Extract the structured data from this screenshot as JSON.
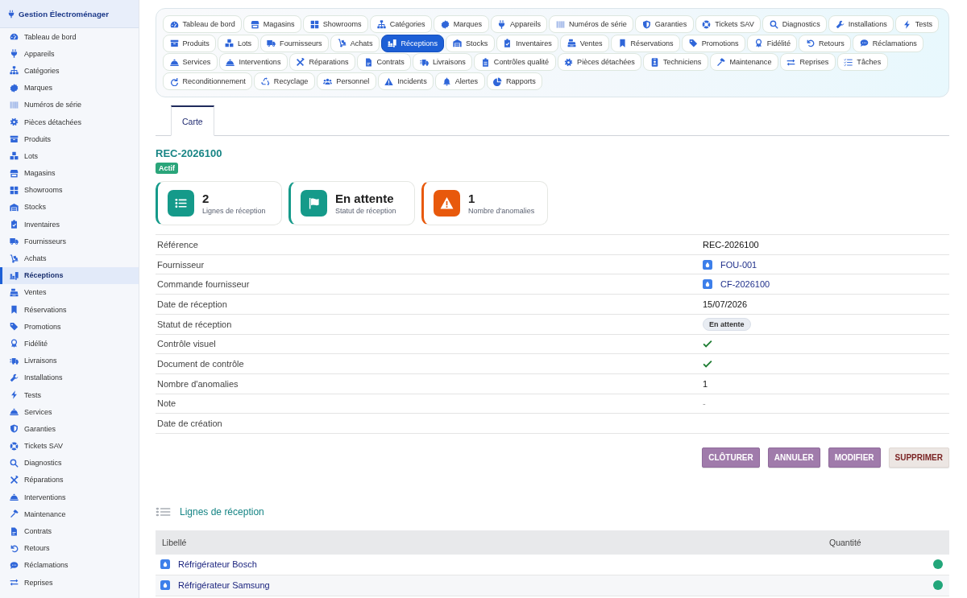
{
  "sidebar": {
    "title": "Gestion Électroménager",
    "items": [
      {
        "label": "Tableau de bord",
        "selected": false
      },
      {
        "label": "Appareils",
        "selected": false
      },
      {
        "label": "Catégories",
        "selected": false
      },
      {
        "label": "Marques",
        "selected": false
      },
      {
        "label": "Numéros de série",
        "selected": false
      },
      {
        "label": "Pièces détachées",
        "selected": false
      },
      {
        "label": "Produits",
        "selected": false
      },
      {
        "label": "Lots",
        "selected": false
      },
      {
        "label": "Magasins",
        "selected": false
      },
      {
        "label": "Showrooms",
        "selected": false
      },
      {
        "label": "Stocks",
        "selected": false
      },
      {
        "label": "Inventaires",
        "selected": false
      },
      {
        "label": "Fournisseurs",
        "selected": false
      },
      {
        "label": "Achats",
        "selected": false
      },
      {
        "label": "Réceptions",
        "selected": true
      },
      {
        "label": "Ventes",
        "selected": false
      },
      {
        "label": "Réservations",
        "selected": false
      },
      {
        "label": "Promotions",
        "selected": false
      },
      {
        "label": "Fidélité",
        "selected": false
      },
      {
        "label": "Livraisons",
        "selected": false
      },
      {
        "label": "Installations",
        "selected": false
      },
      {
        "label": "Tests",
        "selected": false
      },
      {
        "label": "Services",
        "selected": false
      },
      {
        "label": "Garanties",
        "selected": false
      },
      {
        "label": "Tickets SAV",
        "selected": false
      },
      {
        "label": "Diagnostics",
        "selected": false
      },
      {
        "label": "Réparations",
        "selected": false
      },
      {
        "label": "Interventions",
        "selected": false
      },
      {
        "label": "Maintenance",
        "selected": false
      },
      {
        "label": "Contrats",
        "selected": false
      },
      {
        "label": "Retours",
        "selected": false
      },
      {
        "label": "Réclamations",
        "selected": false
      },
      {
        "label": "Reprises",
        "selected": false
      }
    ]
  },
  "nav": {
    "items": [
      {
        "label": "Tableau de bord",
        "selected": false
      },
      {
        "label": "Magasins",
        "selected": false
      },
      {
        "label": "Showrooms",
        "selected": false
      },
      {
        "label": "Catégories",
        "selected": false
      },
      {
        "label": "Marques",
        "selected": false
      },
      {
        "label": "Appareils",
        "selected": false
      },
      {
        "label": "Numéros de série",
        "selected": false
      },
      {
        "label": "Garanties",
        "selected": false
      },
      {
        "label": "Tickets SAV",
        "selected": false
      },
      {
        "label": "Diagnostics",
        "selected": false
      },
      {
        "label": "Installations",
        "selected": false
      },
      {
        "label": "Tests",
        "selected": false
      },
      {
        "label": "Produits",
        "selected": false
      },
      {
        "label": "Lots",
        "selected": false
      },
      {
        "label": "Fournisseurs",
        "selected": false
      },
      {
        "label": "Achats",
        "selected": false
      },
      {
        "label": "Réceptions",
        "selected": true
      },
      {
        "label": "Stocks",
        "selected": false
      },
      {
        "label": "Inventaires",
        "selected": false
      },
      {
        "label": "Ventes",
        "selected": false
      },
      {
        "label": "Réservations",
        "selected": false
      },
      {
        "label": "Promotions",
        "selected": false
      },
      {
        "label": "Fidélité",
        "selected": false
      },
      {
        "label": "Retours",
        "selected": false
      },
      {
        "label": "Réclamations",
        "selected": false
      },
      {
        "label": "Services",
        "selected": false
      },
      {
        "label": "Interventions",
        "selected": false
      },
      {
        "label": "Réparations",
        "selected": false
      },
      {
        "label": "Contrats",
        "selected": false
      },
      {
        "label": "Livraisons",
        "selected": false
      },
      {
        "label": "Contrôles qualité",
        "selected": false
      },
      {
        "label": "Pièces détachées",
        "selected": false
      },
      {
        "label": "Techniciens",
        "selected": false
      },
      {
        "label": "Maintenance",
        "selected": false
      },
      {
        "label": "Reprises",
        "selected": false
      },
      {
        "label": "Tâches",
        "selected": false
      },
      {
        "label": "Reconditionnement",
        "selected": false
      },
      {
        "label": "Recyclage",
        "selected": false
      },
      {
        "label": "Personnel",
        "selected": false
      },
      {
        "label": "Incidents",
        "selected": false
      },
      {
        "label": "Alertes",
        "selected": false
      },
      {
        "label": "Rapports",
        "selected": false
      }
    ]
  },
  "tabs": [
    {
      "label": "Carte",
      "selected": true
    }
  ],
  "record": {
    "title": "REC-2026100",
    "badge": "Actif"
  },
  "stats": [
    {
      "value": "2",
      "label": "Lignes de réception",
      "color": "#159a8a"
    },
    {
      "value": "En attente",
      "label": "Statut de réception",
      "color": "#159a8a"
    },
    {
      "value": "1",
      "label": "Nombre d'anomalies",
      "color": "#e8590c"
    }
  ],
  "details": [
    {
      "label": "Référence",
      "kind": "text",
      "value": "REC-2026100"
    },
    {
      "label": "Fournisseur",
      "kind": "link",
      "value": "FOU-001"
    },
    {
      "label": "Commande fournisseur",
      "kind": "link",
      "value": "CF-2026100"
    },
    {
      "label": "Date de réception",
      "kind": "text",
      "value": "15/07/2026"
    },
    {
      "label": "Statut de réception",
      "kind": "chip",
      "value": "En attente"
    },
    {
      "label": "Contrôle visuel",
      "kind": "check",
      "checked": true
    },
    {
      "label": "Document de contrôle",
      "kind": "check",
      "checked": true
    },
    {
      "label": "Nombre d'anomalies",
      "kind": "text",
      "value": "1"
    },
    {
      "label": "Note",
      "kind": "muted",
      "value": "-"
    },
    {
      "label": "Date de création",
      "kind": "text"
    }
  ],
  "actions": [
    {
      "label": "CLÔTURER",
      "kind": "primary"
    },
    {
      "label": "ANNULER",
      "kind": "primary"
    },
    {
      "label": "MODIFIER",
      "kind": "primary"
    },
    {
      "label": "SUPPRIMER",
      "kind": "danger"
    }
  ],
  "lines": {
    "title": "Lignes de réception",
    "columns": [
      "Libellé",
      "Quantité"
    ],
    "rows": [
      {
        "label": "Réfrigérateur Bosch",
        "color": "#22a67a"
      },
      {
        "label": "Réfrigérateur Samsung",
        "color": "#22a67a"
      }
    ]
  }
}
